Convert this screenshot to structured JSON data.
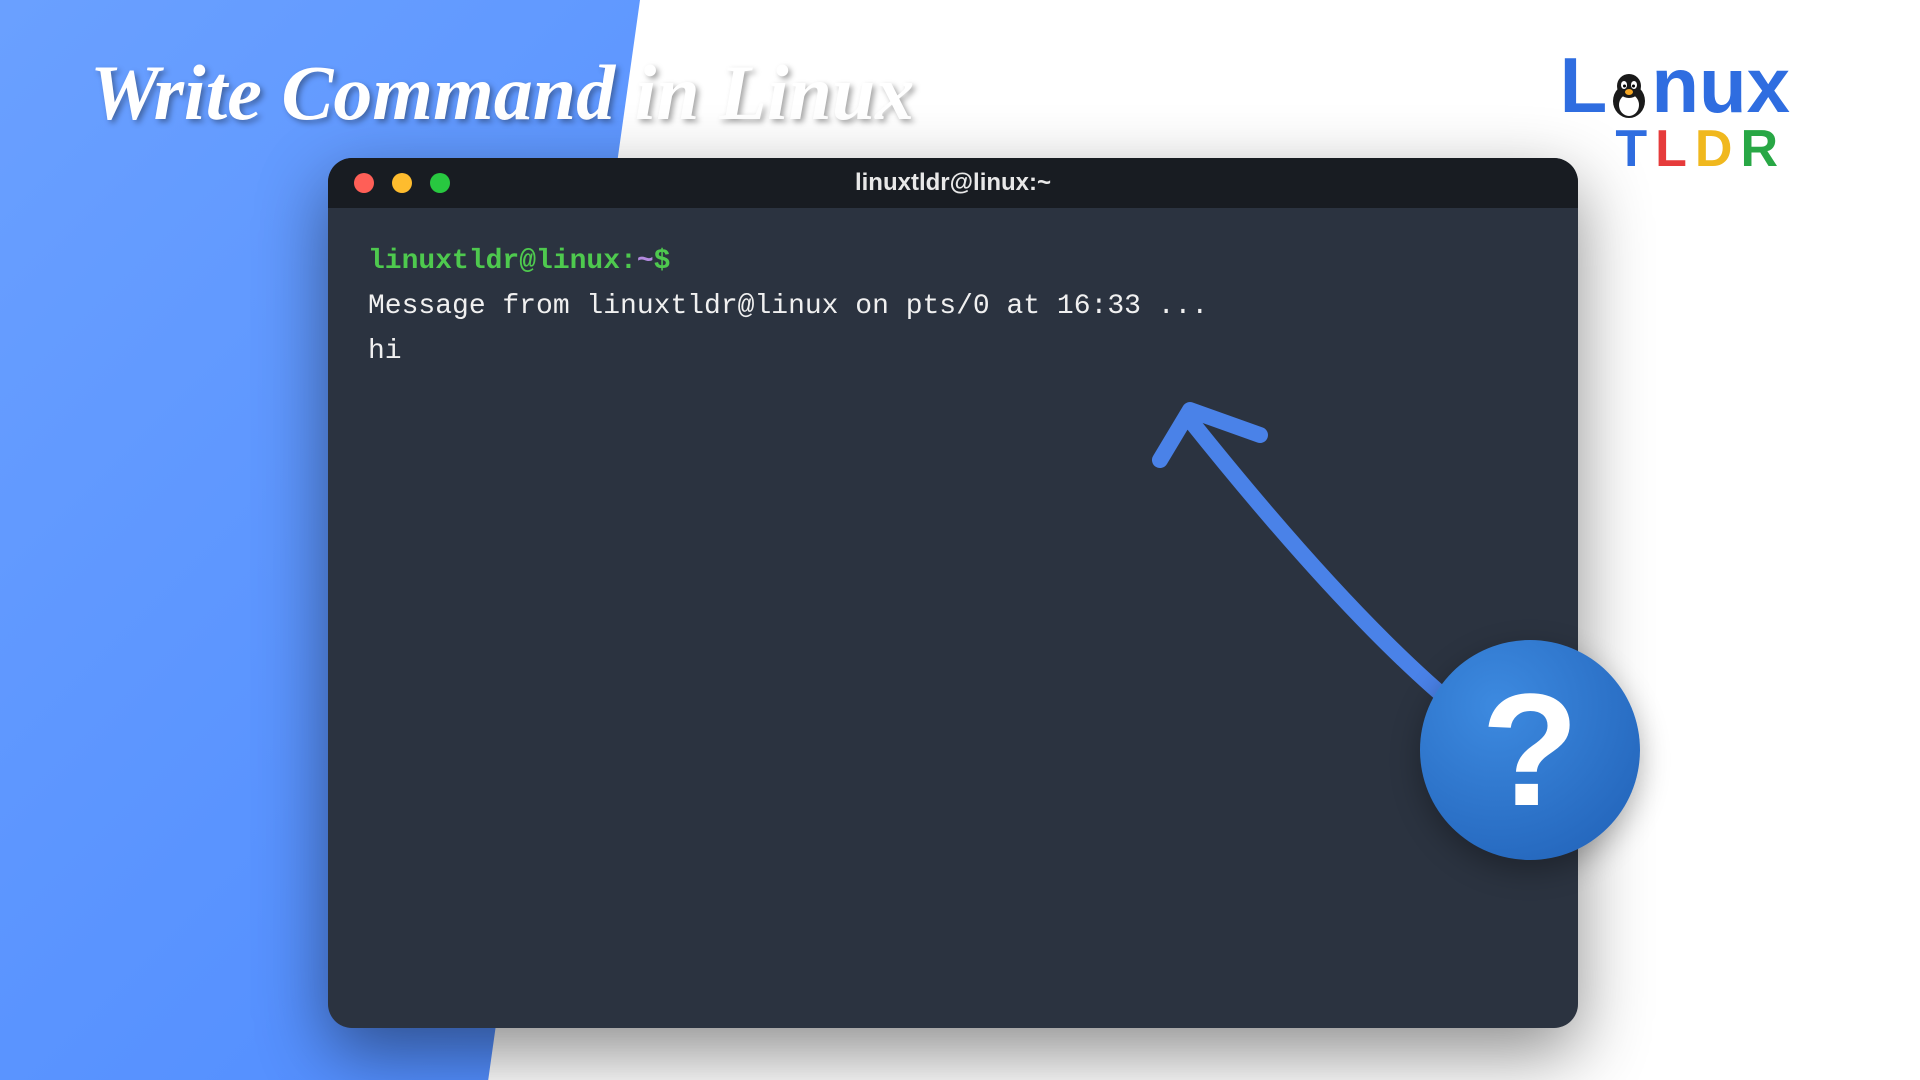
{
  "page": {
    "title": "Write Command in Linux"
  },
  "logo": {
    "main_l": "L",
    "main_nux": "nux",
    "tldr_t": "T",
    "tldr_l": "L",
    "tldr_d": "D",
    "tldr_r": "R"
  },
  "terminal": {
    "title": "linuxtldr@linux:~",
    "prompt": {
      "user": "linuxtldr@linux",
      "colon": ":",
      "path": "~",
      "dollar": "$"
    },
    "lines": {
      "msg": "Message from linuxtldr@linux on pts/0 at 16:33 ...",
      "hi": "hi"
    }
  },
  "annotation": {
    "symbol": "?"
  }
}
